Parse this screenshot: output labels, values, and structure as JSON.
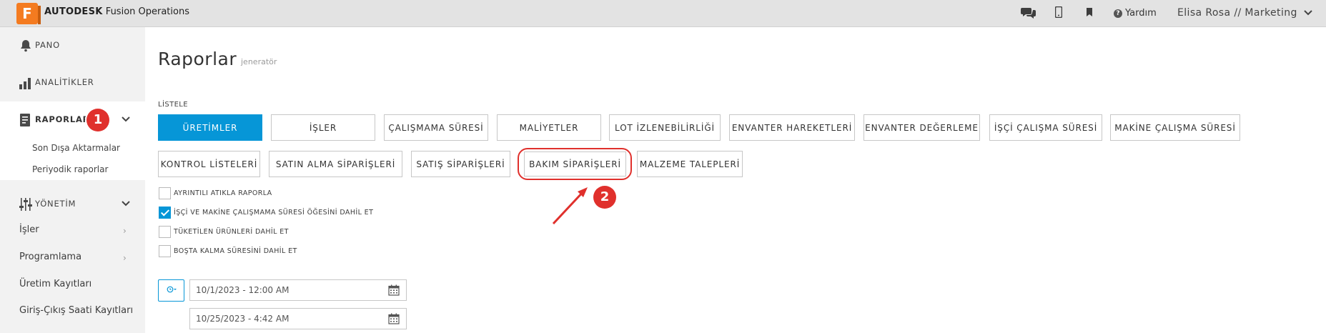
{
  "topbar": {
    "logo_letter": "F",
    "brand_bold": "AUTODESK",
    "brand_rest": "Fusion Operations",
    "icons": [
      "chat-icon",
      "mobile-icon",
      "bookmark-icon"
    ],
    "help_label": "Yardım",
    "user_label": "Elisa Rosa // Marketing"
  },
  "sidebar": {
    "pano": "PANO",
    "analitikler": "ANALİTİKLER",
    "raporlar": "RAPORLAR",
    "raporlar_sub": [
      "Son Dışa Aktarmalar",
      "Periyodik raporlar"
    ],
    "yonetim": "YÖNETİM",
    "isler": "İşler",
    "programlama": "Programlama",
    "uretim_kayitlari": "Üretim Kayıtları",
    "giris_cikis": "Giriş-Çıkış Saati Kayıtları"
  },
  "annotations": {
    "step1": "1",
    "step2": "2",
    "accent_red": "#e0302c"
  },
  "main": {
    "title": "Raporlar",
    "subtitle": "jeneratör",
    "list_label": "LİSTELE",
    "row1": [
      "ÜRETİMLER",
      "İŞLER",
      "ÇALIŞMAMA SÜRESİ",
      "MALİYETLER",
      "LOT İZLENEBİLİRLİĞİ",
      "ENVANTER HAREKETLERİ",
      "ENVANTER DEĞERLEME",
      "İŞÇİ ÇALIŞMA SÜRESİ",
      "MAKİNE ÇALIŞMA SÜRESİ"
    ],
    "row2": [
      "KONTROL LİSTELERİ",
      "SATIN ALMA SİPARİŞLERİ",
      "SATIŞ SİPARİŞLERİ",
      "BAKIM SİPARİŞLERİ",
      "MALZEME TALEPLERİ"
    ],
    "active_button": "ÜRETİMLER",
    "accent_color": "#0696d7",
    "checkboxes": [
      {
        "label": "AYRINTILI ATIKLA RAPORLA",
        "checked": false
      },
      {
        "label": "İŞÇİ VE MAKİNE ÇALIŞMAMA SÜRESİ ÖĞESİNİ DAHİL ET",
        "checked": true
      },
      {
        "label": "TÜKETİLEN ÜRÜNLERİ DAHİL ET",
        "checked": false
      },
      {
        "label": "BOŞTA KALMA SÜRESİNİ DAHİL ET",
        "checked": false
      }
    ],
    "date_from": "10/1/2023 - 12:00 AM",
    "date_to": "10/25/2023 - 4:42 AM"
  }
}
